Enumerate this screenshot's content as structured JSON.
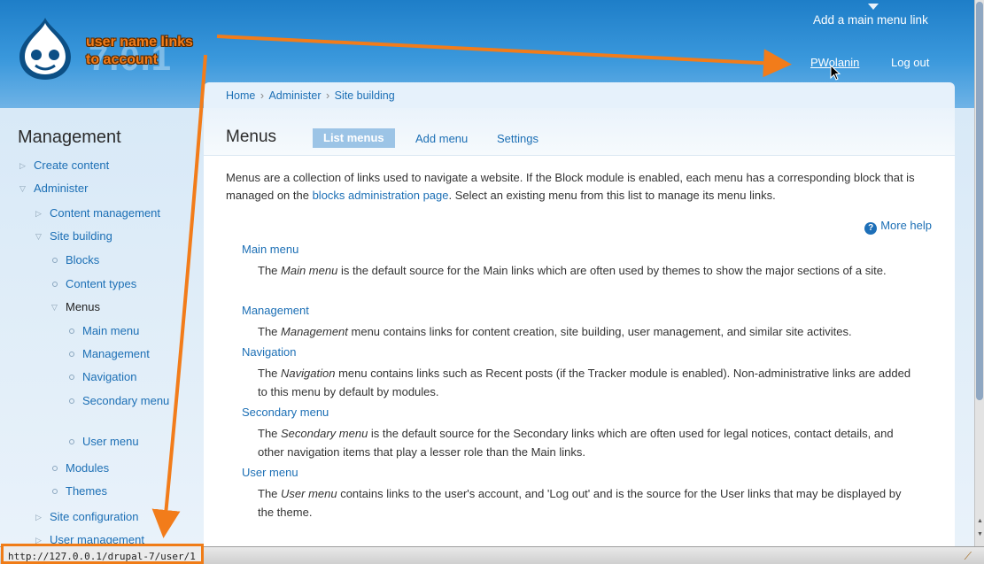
{
  "header": {
    "site_name": "7.0.1",
    "add_link": "Add a main menu link",
    "user_link": "PWolanin",
    "logout": "Log out"
  },
  "breadcrumb": [
    "Home",
    "Administer",
    "Site building"
  ],
  "sidebar": {
    "title": "Management",
    "items": [
      {
        "label": "Create content"
      },
      {
        "label": "Administer"
      },
      {
        "label": "Content management"
      },
      {
        "label": "Site building"
      },
      {
        "label": "Blocks"
      },
      {
        "label": "Content types"
      },
      {
        "label": "Menus"
      },
      {
        "label": "Main menu"
      },
      {
        "label": "Management"
      },
      {
        "label": "Navigation"
      },
      {
        "label": "Secondary menu"
      },
      {
        "label": "User menu"
      },
      {
        "label": "Modules"
      },
      {
        "label": "Themes"
      },
      {
        "label": "Site configuration"
      },
      {
        "label": "User management"
      }
    ]
  },
  "page": {
    "title": "Menus",
    "tabs": [
      "List menus",
      "Add menu",
      "Settings"
    ],
    "intro_before": "Menus are a collection of links used to navigate a website. If the Block module is enabled, each menu has a corresponding block that is managed on the ",
    "intro_link": "blocks administration page",
    "intro_after": ". Select an existing menu from this list to manage its menu links.",
    "more_help": "More help",
    "menus": [
      {
        "name": "Main menu",
        "pre": "The ",
        "em": "Main menu",
        "post": " is the default source for the Main links which are often used by themes to show the major sections of a site."
      },
      {
        "name": "Management",
        "pre": "The ",
        "em": "Management",
        "post": " menu contains links for content creation, site building, user management, and similar site activites."
      },
      {
        "name": "Navigation",
        "pre": "The ",
        "em": "Navigation",
        "post": " menu contains links such as Recent posts (if the Tracker module is enabled). Non-administrative links are added to this menu by default by modules."
      },
      {
        "name": "Secondary menu",
        "pre": "The ",
        "em": "Secondary menu",
        "post": " is the default source for the Secondary links which are often used for legal notices, contact details, and other navigation items that play a lesser role than the Main links."
      },
      {
        "name": "User menu",
        "pre": "The ",
        "em": "User menu",
        "post": " contains links to the user's account, and 'Log out' and is the source for the User links that may be displayed by the theme."
      }
    ]
  },
  "statusbar": {
    "url": "http://127.0.0.1/drupal-7/user/1"
  },
  "annotation": {
    "line1": "user name links",
    "line2": "to account"
  },
  "colors": {
    "accent": "#f27c1a",
    "link": "#1c6fb5",
    "header": "#2b8bd4"
  },
  "icons": [
    "drupal-logo-icon",
    "help-icon",
    "cursor-icon",
    "resize-grip-icon",
    "collapsed-triangle-icon",
    "expanded-triangle-icon",
    "bullet-icon"
  ]
}
